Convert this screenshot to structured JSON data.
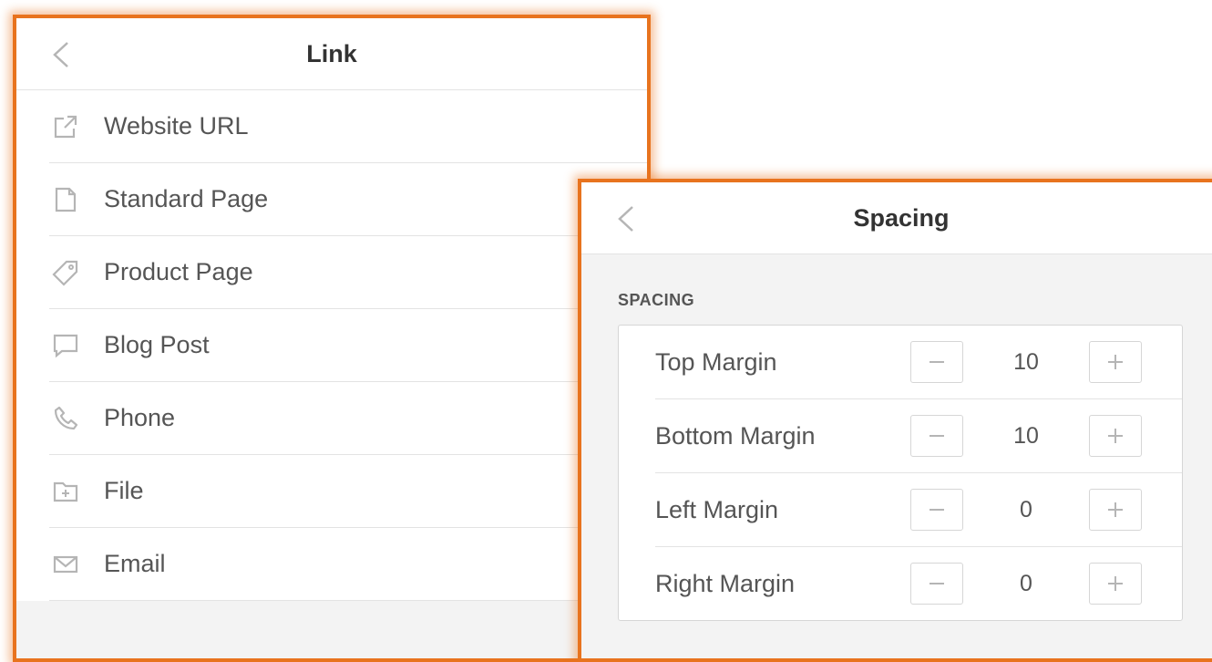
{
  "link_panel": {
    "title": "Link",
    "items": [
      {
        "label": "Website URL",
        "icon": "external-link-icon"
      },
      {
        "label": "Standard Page",
        "icon": "page-icon"
      },
      {
        "label": "Product Page",
        "icon": "tag-icon"
      },
      {
        "label": "Blog Post",
        "icon": "comment-icon"
      },
      {
        "label": "Phone",
        "icon": "phone-icon"
      },
      {
        "label": "File",
        "icon": "folder-icon"
      },
      {
        "label": "Email",
        "icon": "envelope-icon"
      }
    ]
  },
  "spacing_panel": {
    "title": "Spacing",
    "section_label": "SPACING",
    "rows": [
      {
        "label": "Top Margin",
        "value": "10"
      },
      {
        "label": "Bottom Margin",
        "value": "10"
      },
      {
        "label": "Left Margin",
        "value": "0"
      },
      {
        "label": "Right Margin",
        "value": "0"
      }
    ]
  },
  "colors": {
    "accent_border": "#e8731e",
    "icon_gray": "#b5b5b5",
    "text": "#555555"
  }
}
